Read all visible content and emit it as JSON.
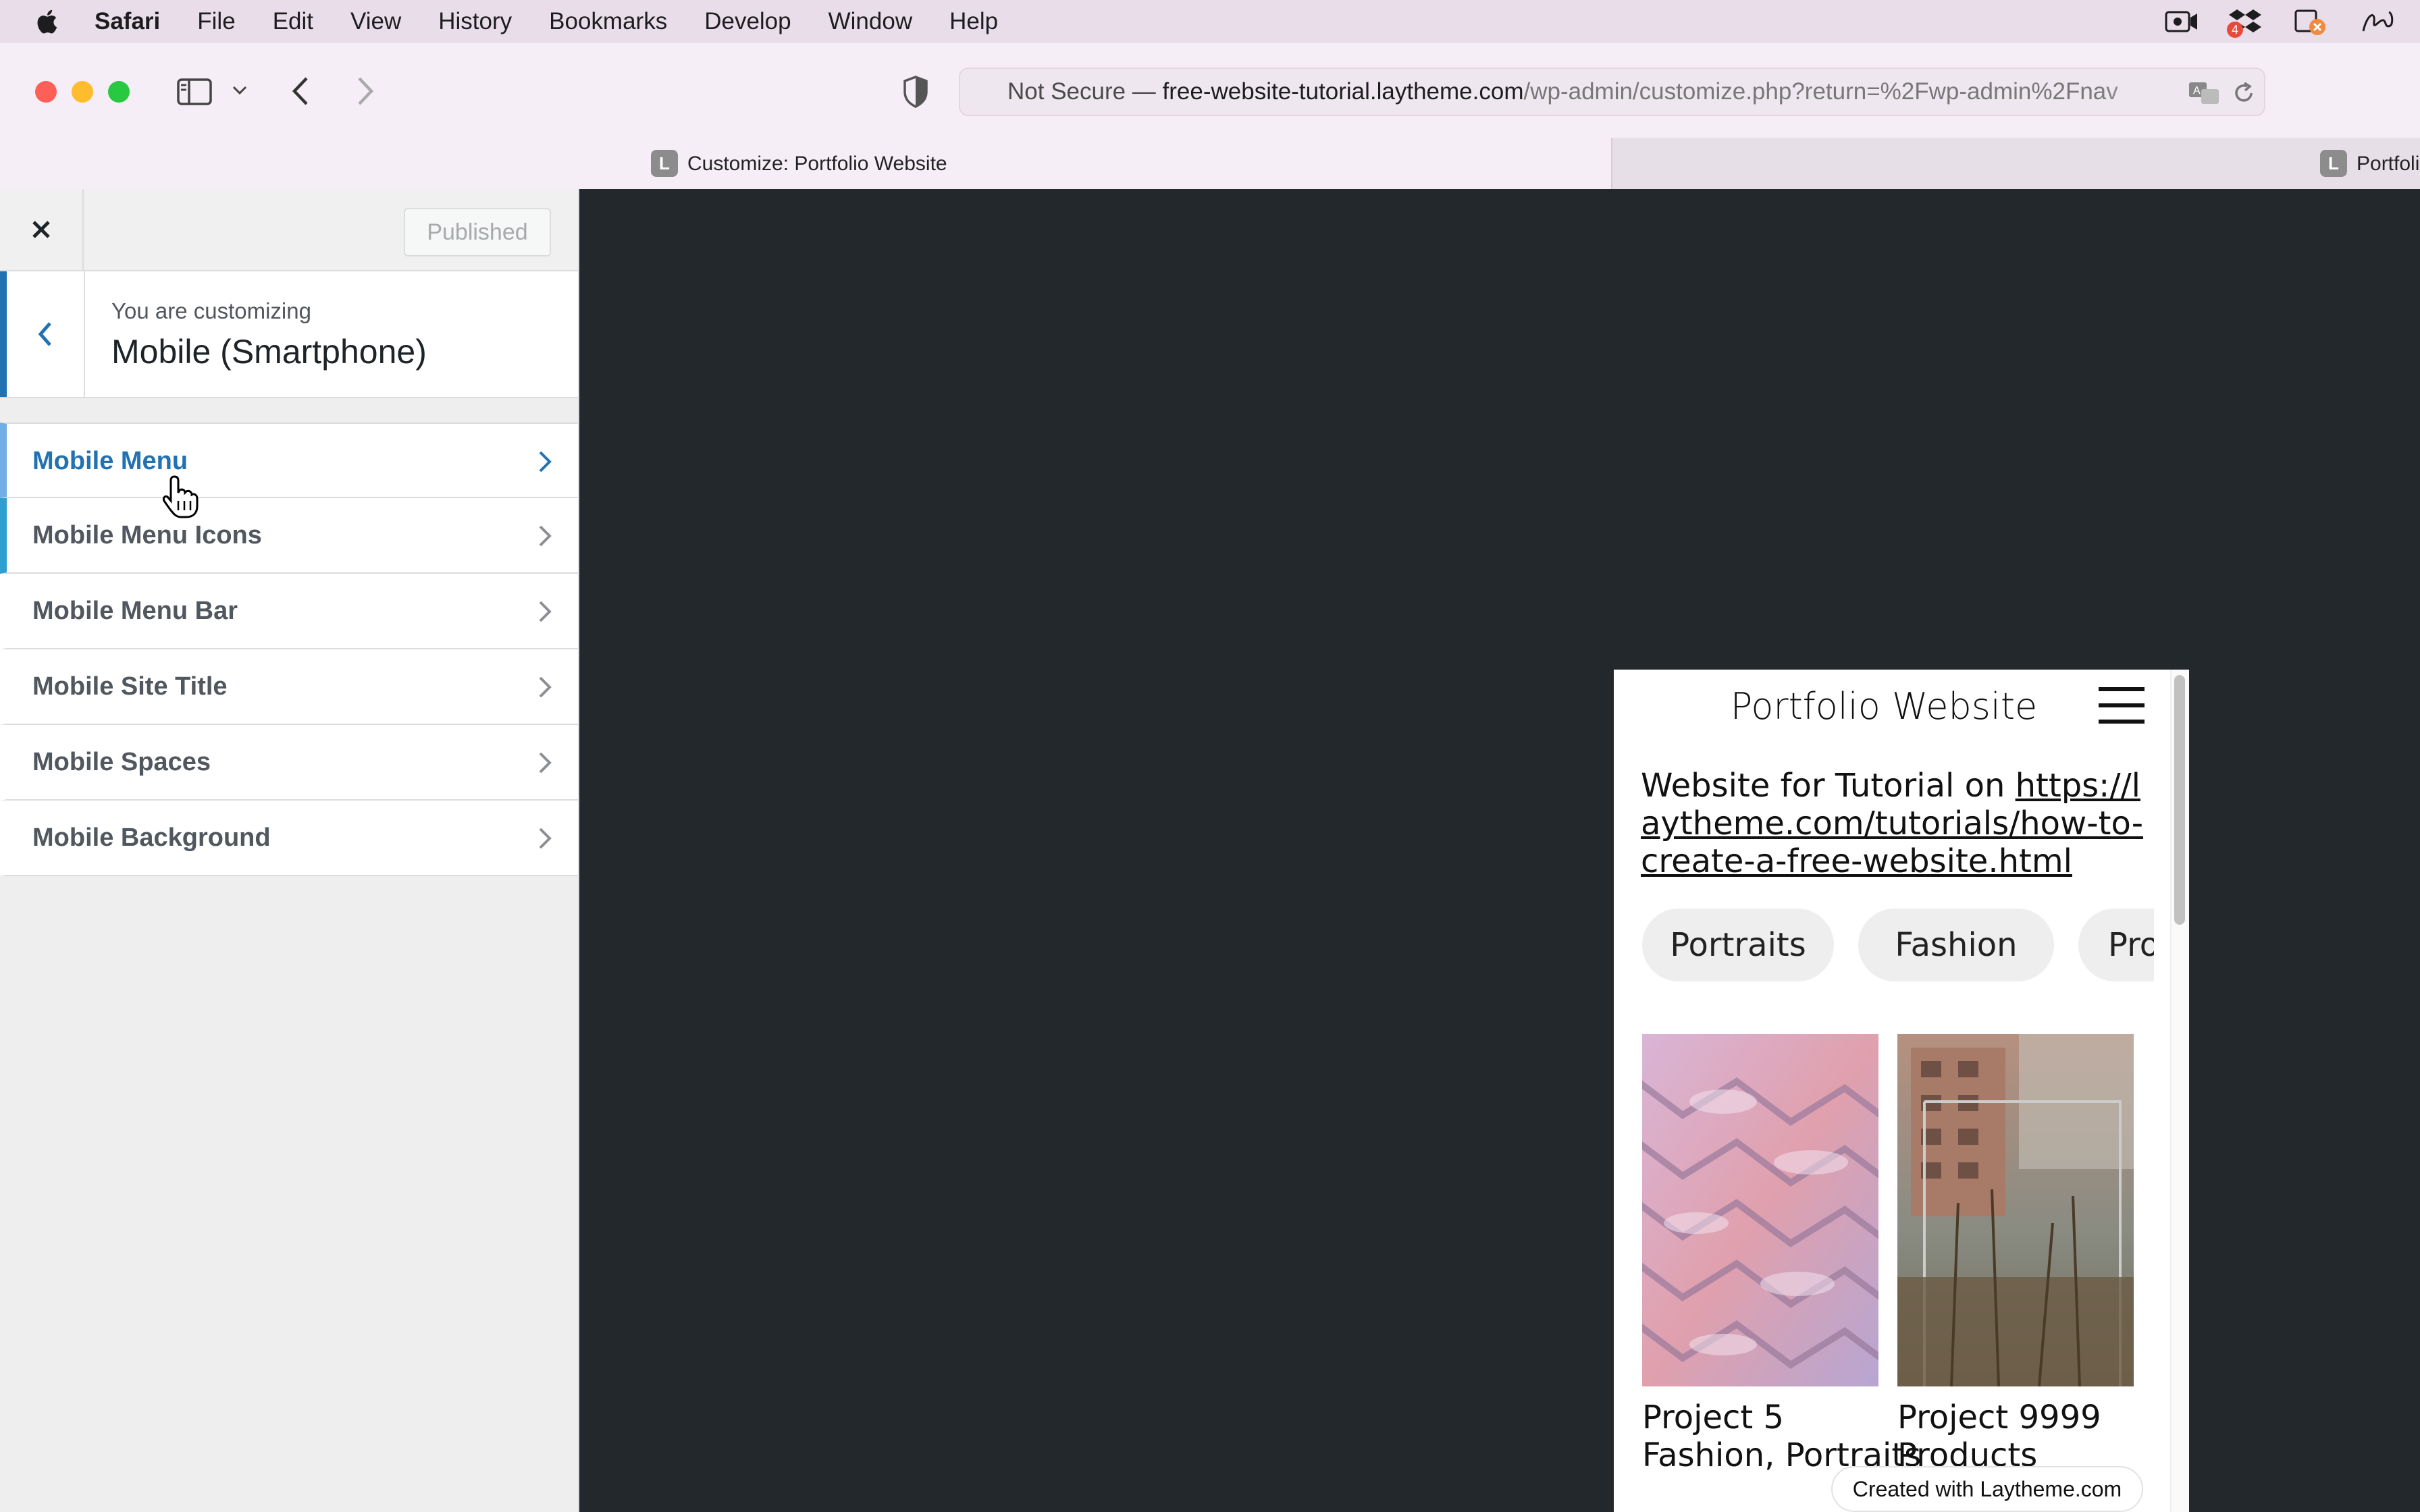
{
  "menubar": {
    "app_name": "Safari",
    "items": [
      "File",
      "Edit",
      "View",
      "History",
      "Bookmarks",
      "Develop",
      "Window",
      "Help"
    ],
    "dropbox_badge": "4"
  },
  "browser": {
    "url_prefix": "Not Secure — ",
    "url_host": "free-website-tutorial.laytheme.com",
    "url_path": "/wp-admin/customize.php?return=%2Fwp-admin%2Fnav",
    "tabs": [
      {
        "favicon": "L",
        "title": "Customize: Portfolio Website"
      },
      {
        "favicon": "L",
        "title": "Portfolio"
      }
    ]
  },
  "customizer": {
    "published_label": "Published",
    "customizing_label": "You are customizing",
    "section_name": "Mobile (Smartphone)",
    "panels": [
      {
        "label": "Mobile Menu"
      },
      {
        "label": "Mobile Menu Icons"
      },
      {
        "label": "Mobile Menu Bar"
      },
      {
        "label": "Mobile Site Title"
      },
      {
        "label": "Mobile Spaces"
      },
      {
        "label": "Mobile Background"
      }
    ]
  },
  "preview": {
    "site_title": "Portfolio Website",
    "description_text": "Website for Tutorial on ",
    "description_link": "https://laytheme.com/tutorials/how-to-create-a-free-website.html",
    "filters": [
      "Portraits",
      "Fashion",
      "Products"
    ],
    "projects": [
      {
        "title": "Project 5",
        "tags": "Fashion, Portraits"
      },
      {
        "title": "Project 9999",
        "tags": "Products"
      }
    ],
    "badge": "Created with Laytheme.com"
  },
  "colors": {
    "wp_blue": "#2271b1",
    "accent_active": "#72aee6",
    "preview_bg": "#23282d",
    "menubar_bg": "#e9dde9"
  }
}
